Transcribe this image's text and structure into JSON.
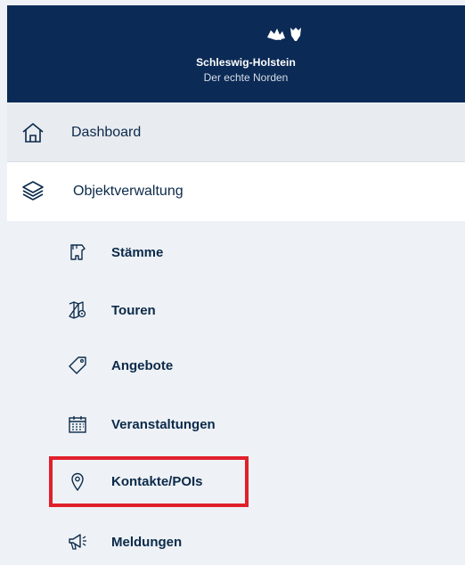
{
  "header": {
    "logo_name": "Schleswig-Holstein",
    "logo_tagline": "Der echte Norden",
    "logo_icon": "lion-heraldry-icon",
    "background_color": "#0b2a55"
  },
  "nav": {
    "dashboard": {
      "label": "Dashboard",
      "icon": "home-icon"
    },
    "objektverwaltung": {
      "label": "Objektverwaltung",
      "icon": "layers-icon"
    }
  },
  "subnav": [
    {
      "label": "Stämme",
      "icon": "stump-icon"
    },
    {
      "label": "Touren",
      "icon": "map-pin-icon"
    },
    {
      "label": "Angebote",
      "icon": "tag-icon"
    },
    {
      "label": "Veranstaltungen",
      "icon": "calendar-icon"
    },
    {
      "label": "Kontakte/POIs",
      "icon": "location-pin-icon"
    },
    {
      "label": "Meldungen",
      "icon": "megaphone-icon"
    }
  ],
  "highlight": {
    "target": "Kontakte/POIs",
    "color": "#e0202b"
  }
}
